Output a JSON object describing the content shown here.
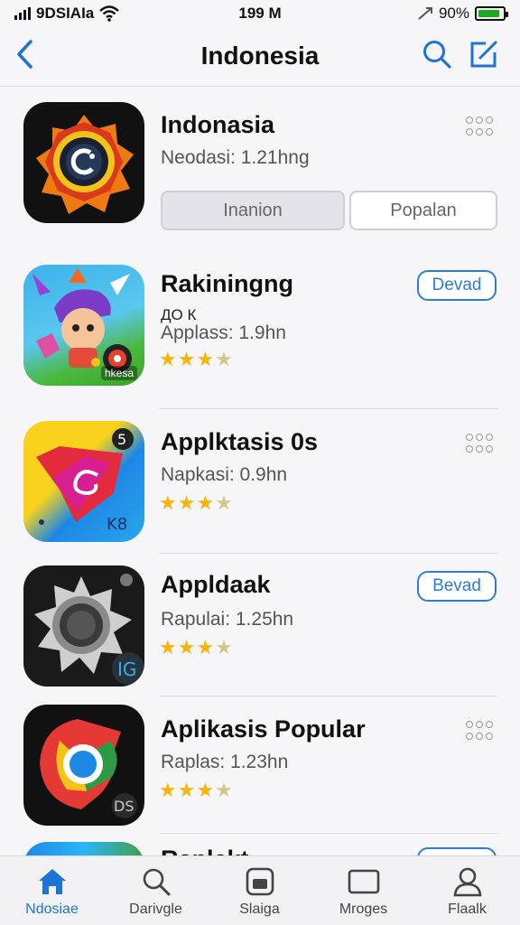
{
  "status_bar": {
    "carrier": "9DSIAIa",
    "time": "199 M",
    "battery_percent": "90%",
    "battery_level": 0.9,
    "battery_color": "#1fa91f"
  },
  "nav": {
    "title": "Indonesia",
    "back_icon": "chevron-left-icon",
    "search_icon": "search-icon",
    "compose_icon": "compose-icon",
    "accent": "#1d74d6"
  },
  "header_app": {
    "name": "Indonasia",
    "subtitle": "Neodasi: 1.21hng",
    "segment_left": "Inanion",
    "segment_right": "Popalan"
  },
  "apps": [
    {
      "name": "Rakiningng",
      "extra": "ДО К",
      "subtitle": "Applass: 1.9hn",
      "rating": 3.5,
      "action": "Devad",
      "action_type": "button",
      "badge": "hkesa"
    },
    {
      "name": "Applktasis 0s",
      "subtitle": "Napkasi: 0.9hn",
      "rating": 3.5,
      "action_type": "more"
    },
    {
      "name": "Appldaak",
      "subtitle": "Rapulai: 1.25hn",
      "rating": 3.5,
      "action": "Bevad",
      "action_type": "button"
    },
    {
      "name": "Aplikasis Popular",
      "subtitle": "Raplas: 1.23hn",
      "rating": 3.5,
      "action_type": "more"
    },
    {
      "name": "Raplekt",
      "action_type": "button"
    }
  ],
  "tabs": [
    {
      "label": "Ndosiae",
      "icon": "home-icon",
      "active": true
    },
    {
      "label": "Darivgle",
      "icon": "search-icon",
      "active": false
    },
    {
      "label": "Slaiga",
      "icon": "app-store-icon",
      "active": false
    },
    {
      "label": "Mroges",
      "icon": "window-icon",
      "active": false
    },
    {
      "label": "Flaalk",
      "icon": "person-icon",
      "active": false
    }
  ]
}
